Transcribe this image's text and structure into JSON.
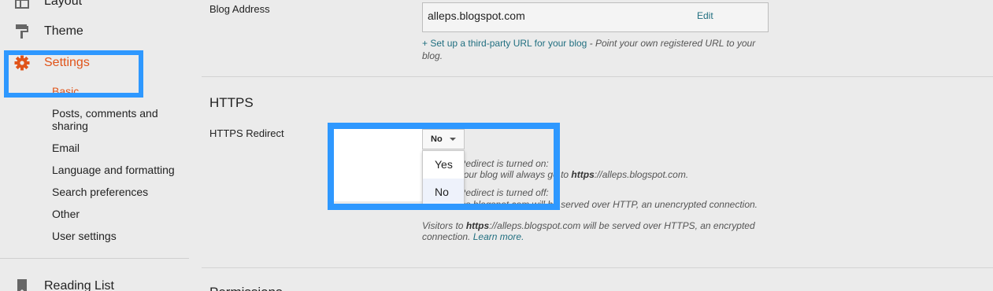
{
  "sidebar": {
    "items": {
      "layout": "Layout",
      "theme": "Theme",
      "settings": "Settings",
      "reading_list": "Reading List"
    },
    "settings_sub": [
      "Basic",
      "Posts, comments and sharing",
      "Email",
      "Language and formatting",
      "Search preferences",
      "Other",
      "User settings"
    ]
  },
  "blog_address": {
    "label": "Blog Address",
    "value": "alleps.blogspot.com",
    "edit": "Edit",
    "third_party_link": "+ Set up a third-party URL for your blog",
    "third_party_desc": " - Point your own registered URL to your blog."
  },
  "https": {
    "title": "HTTPS",
    "redirect_label": "HTTPS Redirect",
    "select_value": "No",
    "options": [
      "Yes",
      "No"
    ],
    "help_on_1": "Redirect is turned on:",
    "help_on_2": "your blog will always go to ",
    "help_on_url": "https",
    "help_on_rest": "://alleps.blogspot.com.",
    "help_off_1": "Redirect is turned off:",
    "help_off_2": "http://alleps.blogspot.com will be served over HTTP, an unencrypted connection.",
    "help_visitors_pre": "Visitors to ",
    "help_visitors_url": "https",
    "help_visitors_rest": "://alleps.blogspot.com will be served over HTTPS, an encrypted connection. ",
    "learn_more": "Learn more."
  },
  "permissions": {
    "title": "Permissions"
  },
  "colors": {
    "accent_orange": "#e0541a",
    "highlight_blue": "#2e98ff",
    "link_teal": "#216f80"
  }
}
